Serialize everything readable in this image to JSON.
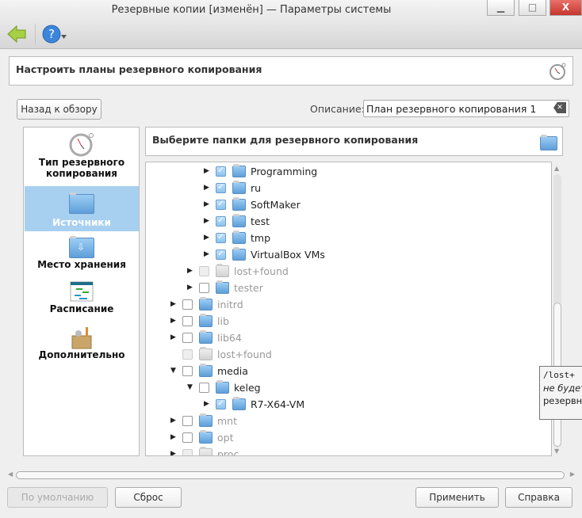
{
  "window": {
    "title": "Резервные копии [изменён] — Параметры системы",
    "minimize": "▁",
    "maximize": "□",
    "close": "X"
  },
  "toolbar": {
    "back_icon": "back-arrow-icon",
    "help_icon": "help-icon"
  },
  "header": {
    "title": "Настроить планы резервного копирования",
    "icon": "stopwatch-icon"
  },
  "controls": {
    "back_label": "Назад к обзору",
    "description_label": "Описание:",
    "description_value": "План резервного копирования 1"
  },
  "sidebar": {
    "items": [
      {
        "label": "Тип резервного копирования",
        "icon": "stopwatch-icon",
        "selected": false
      },
      {
        "label": "Источники",
        "icon": "folder-icon",
        "selected": true
      },
      {
        "label": "Место хранения",
        "icon": "folder-download-icon",
        "selected": false
      },
      {
        "label": "Расписание",
        "icon": "schedule-icon",
        "selected": false
      },
      {
        "label": "Дополнительно",
        "icon": "toolbox-icon",
        "selected": false
      }
    ]
  },
  "main": {
    "title": "Выберите папки для резервного копирования",
    "tree": [
      {
        "label": "Programming",
        "level": 3,
        "arrow": "right",
        "checked": true,
        "state": "normal"
      },
      {
        "label": "ru",
        "level": 3,
        "arrow": "right",
        "checked": true,
        "state": "normal"
      },
      {
        "label": "SoftMaker",
        "level": 3,
        "arrow": "right",
        "checked": true,
        "state": "normal"
      },
      {
        "label": "test",
        "level": 3,
        "arrow": "right",
        "checked": true,
        "state": "normal"
      },
      {
        "label": "tmp",
        "level": 3,
        "arrow": "right",
        "checked": true,
        "state": "normal"
      },
      {
        "label": "VirtualBox VMs",
        "level": 3,
        "arrow": "right",
        "checked": true,
        "state": "normal"
      },
      {
        "label": "lost+found",
        "level": 2,
        "arrow": "right",
        "checked": false,
        "state": "disabled"
      },
      {
        "label": "tester",
        "level": 2,
        "arrow": "right",
        "checked": false,
        "state": "gray"
      },
      {
        "label": "initrd",
        "level": 1,
        "arrow": "right",
        "checked": false,
        "state": "gray"
      },
      {
        "label": "lib",
        "level": 1,
        "arrow": "right",
        "checked": false,
        "state": "gray"
      },
      {
        "label": "lib64",
        "level": 1,
        "arrow": "right",
        "checked": false,
        "state": "gray"
      },
      {
        "label": "lost+found",
        "level": 1,
        "arrow": "none",
        "checked": false,
        "state": "disabled"
      },
      {
        "label": "media",
        "level": 1,
        "arrow": "down",
        "checked": false,
        "state": "normal"
      },
      {
        "label": "keleg",
        "level": 2,
        "arrow": "down",
        "checked": false,
        "state": "normal"
      },
      {
        "label": "R7-X64-VM",
        "level": 3,
        "arrow": "right",
        "checked": true,
        "state": "normal"
      },
      {
        "label": "mnt",
        "level": 1,
        "arrow": "right",
        "checked": false,
        "state": "gray"
      },
      {
        "label": "opt",
        "level": 1,
        "arrow": "right",
        "checked": false,
        "state": "gray"
      },
      {
        "label": "proc",
        "level": 1,
        "arrow": "right",
        "checked": false,
        "state": "disabled"
      }
    ]
  },
  "tooltip": {
    "line1": "/lost+",
    "line2": "не будет",
    "line3": "резервн"
  },
  "footer": {
    "defaults": "По умолчанию",
    "reset": "Сброс",
    "apply": "Применить",
    "help": "Справка"
  }
}
